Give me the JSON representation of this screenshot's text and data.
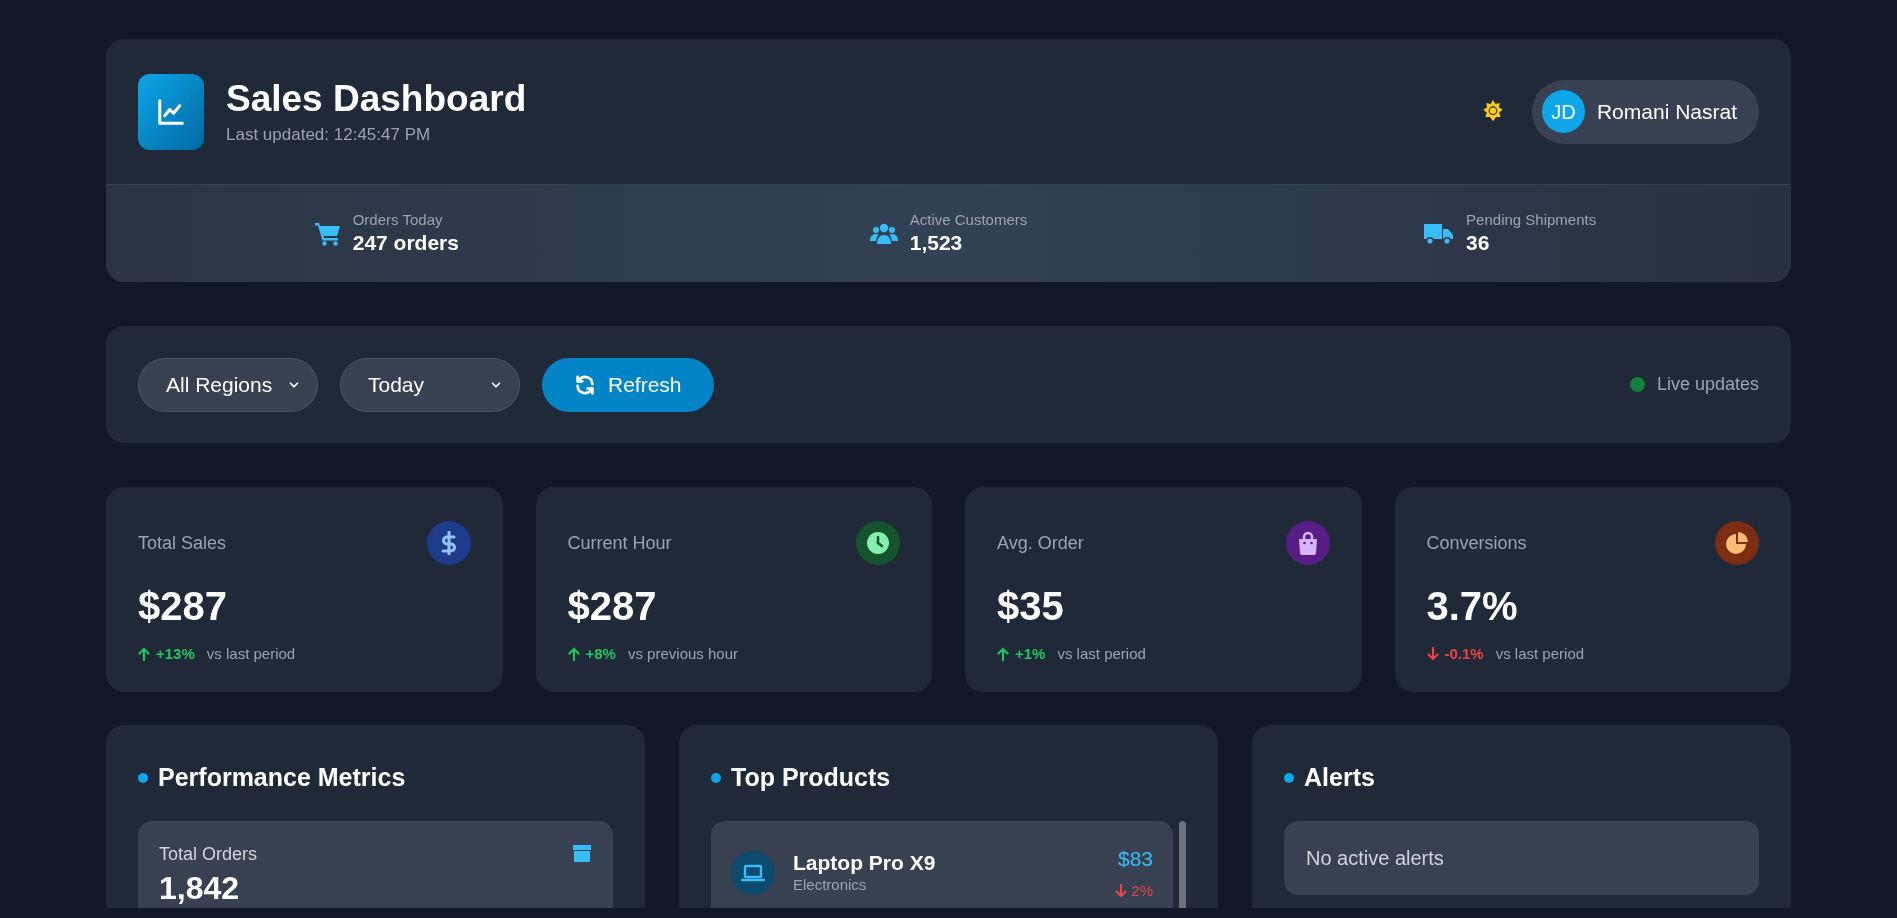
{
  "header": {
    "title": "Sales Dashboard",
    "last_updated": "Last updated: 12:45:47 PM",
    "user": {
      "initials": "JD",
      "name": "Romani Nasrat"
    }
  },
  "summary": [
    {
      "kind": "cart",
      "label": "Orders Today",
      "value": "247 orders"
    },
    {
      "kind": "users",
      "label": "Active Customers",
      "value": "1,523"
    },
    {
      "kind": "truck",
      "label": "Pending Shipments",
      "value": "36"
    }
  ],
  "filters": {
    "selects": [
      {
        "value": "All Regions"
      },
      {
        "value": "Today"
      }
    ],
    "refresh": "Refresh",
    "live": {
      "label": "Live updates",
      "on": true
    }
  },
  "stats": [
    {
      "kind": "dollar",
      "label": "Total Sales",
      "value": "$287",
      "change": "+13%",
      "up": true,
      "note": "vs last period"
    },
    {
      "kind": "clock",
      "label": "Current Hour",
      "value": "$287",
      "change": "+8%",
      "up": true,
      "note": "vs previous hour"
    },
    {
      "kind": "bag",
      "label": "Avg. Order",
      "value": "$35",
      "change": "+1%",
      "up": true,
      "note": "vs last period"
    },
    {
      "kind": "pie",
      "label": "Conversions",
      "value": "3.7%",
      "change": "-0.1%",
      "up": false,
      "note": "vs last period"
    }
  ],
  "panels": [
    {
      "kind": "metrics",
      "title": "Performance Metrics",
      "items": [
        {
          "label": "Total Orders",
          "value": "1,842"
        }
      ]
    },
    {
      "kind": "products",
      "title": "Top Products",
      "items": [
        {
          "name": "Laptop Pro X9",
          "category": "Electronics",
          "price": "$83",
          "change": "2%",
          "up": false
        }
      ]
    },
    {
      "kind": "alerts",
      "title": "Alerts",
      "empty_text": "No active alerts"
    }
  ]
}
